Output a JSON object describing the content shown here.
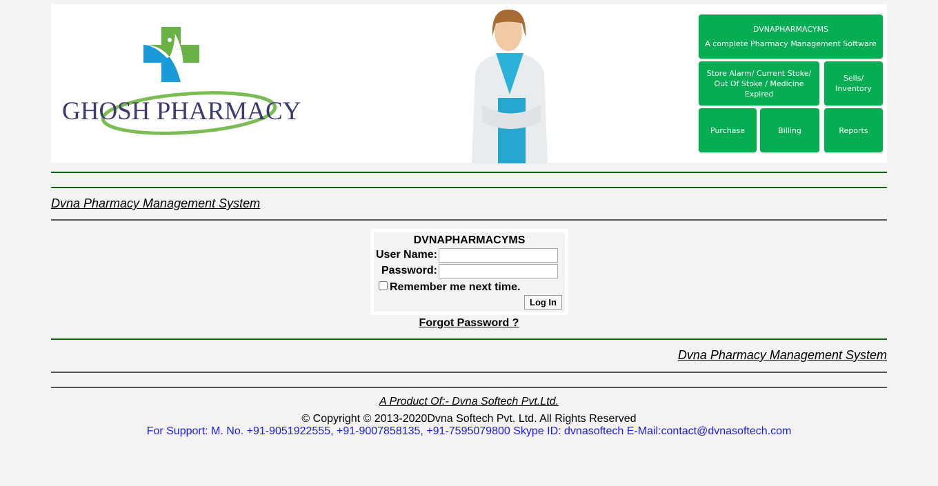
{
  "header": {
    "logo_text": "GHOSH PHARMACY",
    "tiles": {
      "title": "DVNAPHARMACYMS",
      "subtitle": "A complete Pharmacy Management Software",
      "store": "Store Alarm/ Current Stoke/ Out Of Stoke / Medicine Expired",
      "sells": "Sells/ Inventory",
      "purchase": "Purchase",
      "billing": "Billing",
      "reports": "Reports"
    },
    "tile_color": "#07ad52"
  },
  "nav": {
    "title_link": "Dvna Pharmacy Management System"
  },
  "login": {
    "title": "DVNAPHARMACYMS",
    "username_label": "User Name:",
    "username_value": "",
    "password_label": "Password:",
    "password_value": "",
    "remember_label": "Remember me next time.",
    "remember_checked": false,
    "login_button": "Log In",
    "forgot_link": "Forgot Password ?"
  },
  "bottom_link": "Dvna Pharmacy Management System",
  "footer": {
    "product": "A Product Of:- Dvna Softech Pvt.Ltd.",
    "copyright": "© Copyright © 2013-2020Dvna Softech Pvt. Ltd. All Rights Reserved",
    "support": "For Support: M. No. +91-9051922555, +91-9007858135, +91-7595079800 Skype ID: dvnasoftech E-Mail:contact@dvnasoftech.com"
  }
}
